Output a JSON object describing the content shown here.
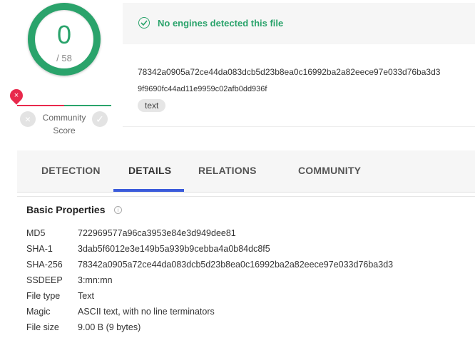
{
  "score": {
    "detections": "0",
    "total": "/ 58"
  },
  "community": {
    "label_line1": "Community",
    "label_line2": "Score",
    "marker_symbol": "×",
    "down_symbol": "×",
    "up_symbol": "✓"
  },
  "summary": {
    "status_text": "No engines detected this file",
    "hash_line1": "78342a0905a72ce44da083dcb5d23b8ea0c16992ba2a82eece97e033d76ba3d3",
    "hash_line2": "9f9690fc44ad11e9959c02afb0dd936f",
    "tag": "text"
  },
  "tabs": [
    {
      "label": "DETECTION"
    },
    {
      "label": "DETAILS"
    },
    {
      "label": "RELATIONS"
    },
    {
      "label": "COMMUNITY"
    }
  ],
  "active_tab": "DETAILS",
  "basic_properties": {
    "title": "Basic Properties",
    "info_symbol": "i",
    "rows": [
      {
        "key": "MD5",
        "value": "722969577a96ca3953e84e3d949dee81"
      },
      {
        "key": "SHA-1",
        "value": "3dab5f6012e3e149b5a939b9cebba4a0b84dc8f5"
      },
      {
        "key": "SHA-256",
        "value": "78342a0905a72ce44da083dcb5d23b8ea0c16992ba2a82eece97e033d76ba3d3"
      },
      {
        "key": "SSDEEP",
        "value": "3:mn:mn"
      },
      {
        "key": "File type",
        "value": "Text"
      },
      {
        "key": "Magic",
        "value": "ASCII text, with no line terminators"
      },
      {
        "key": "File size",
        "value": "9.00 B (9 bytes)"
      }
    ]
  },
  "colors": {
    "accent_green": "#2aa36b",
    "accent_red": "#e8294c",
    "tab_active": "#3b5bdb"
  }
}
